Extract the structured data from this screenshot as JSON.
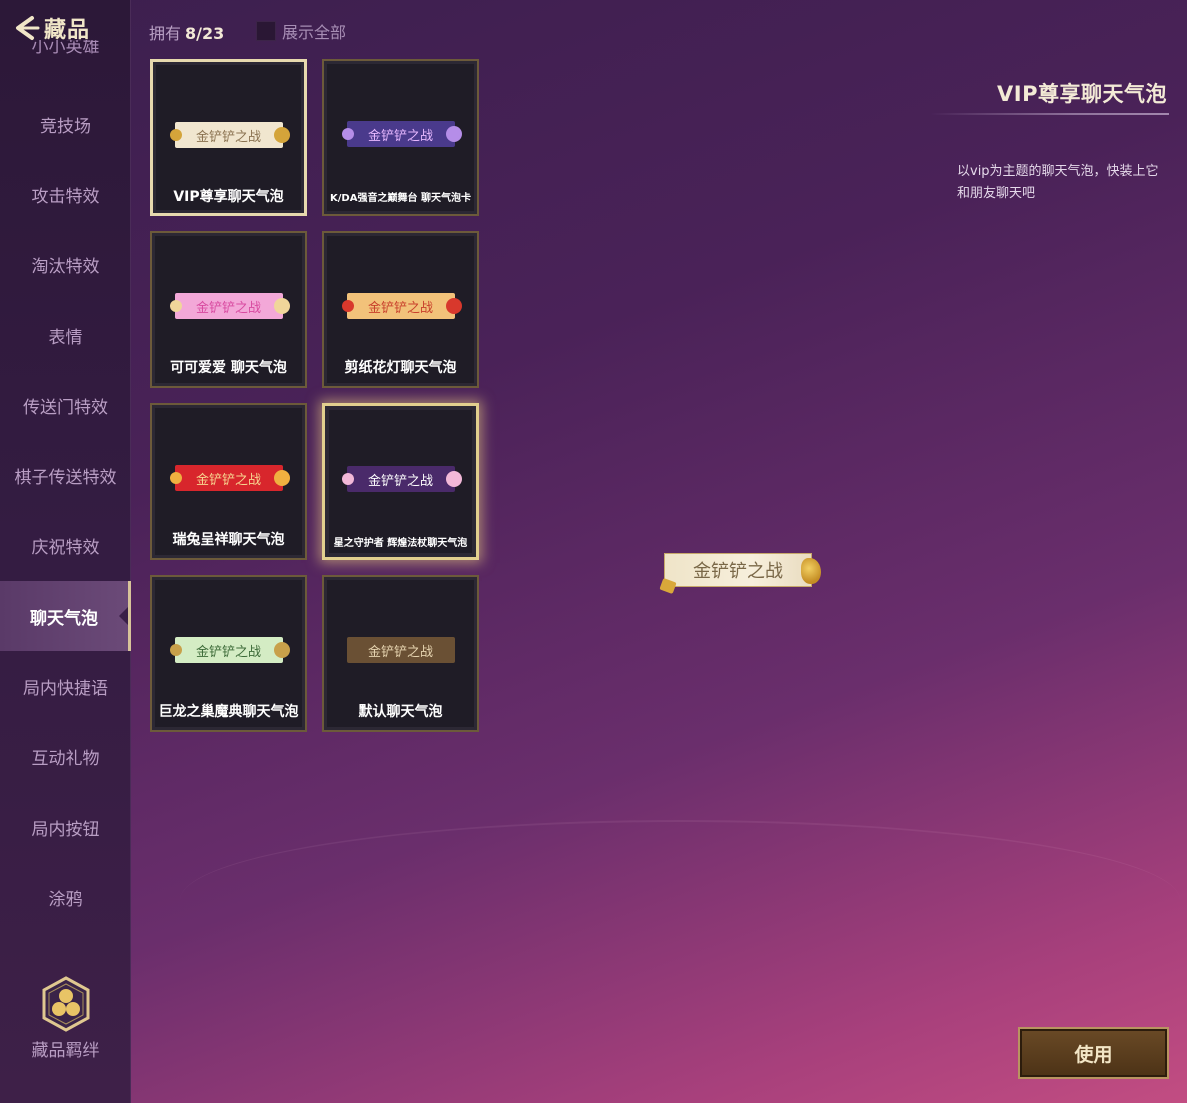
{
  "header": {
    "title": "藏品",
    "owned_label": "拥有",
    "owned_count": "8/23",
    "show_all_label": "展示全部"
  },
  "sidebar": {
    "cut_item": "小小英雄",
    "items": [
      {
        "label": "竞技场"
      },
      {
        "label": "攻击特效"
      },
      {
        "label": "淘汰特效"
      },
      {
        "label": "表情"
      },
      {
        "label": "传送门特效"
      },
      {
        "label": "棋子传送特效"
      },
      {
        "label": "庆祝特效"
      },
      {
        "label": "聊天气泡",
        "active": true
      },
      {
        "label": "局内快捷语"
      },
      {
        "label": "互动礼物"
      },
      {
        "label": "局内按钮"
      },
      {
        "label": "涂鸦"
      }
    ],
    "bond_label": "藏品羁绊"
  },
  "cards": [
    {
      "name": "VIP尊享聊天气泡",
      "bubble_text": "金铲铲之战",
      "bg": "#f1e6cf",
      "fg": "#8a7250",
      "deco": "#d4a43a",
      "state": "equipped"
    },
    {
      "name": "K/DA强音之巅舞台 聊天气泡卡",
      "bubble_text": "金铲铲之战",
      "bg": "#4a3a8c",
      "fg": "#e7b8ff",
      "deco": "#b58de8",
      "state": "",
      "small": true
    },
    {
      "name": "可可爱爱 聊天气泡",
      "bubble_text": "金铲铲之战",
      "bg": "#f3a8d8",
      "fg": "#d84aa0",
      "deco": "#f0d69a",
      "state": ""
    },
    {
      "name": "剪纸花灯聊天气泡",
      "bubble_text": "金铲铲之战",
      "bg": "#f2c27a",
      "fg": "#c8402c",
      "deco": "#d8382c",
      "state": ""
    },
    {
      "name": "瑞兔呈祥聊天气泡",
      "bubble_text": "金铲铲之战",
      "bg": "#d8262c",
      "fg": "#f7d690",
      "deco": "#f0b040",
      "state": ""
    },
    {
      "name": "星之守护者 辉煌法杖聊天气泡",
      "bubble_text": "金铲铲之战",
      "bg": "#4a2a6a",
      "fg": "#ffffff",
      "deco": "#f2b8d8",
      "state": "selected",
      "small": true
    },
    {
      "name": "巨龙之巢魔典聊天气泡",
      "bubble_text": "金铲铲之战",
      "bg": "#d4ecc4",
      "fg": "#3c6a38",
      "deco": "#c8a04a",
      "state": ""
    },
    {
      "name": "默认聊天气泡",
      "bubble_text": "金铲铲之战",
      "bg": "#6a5034",
      "fg": "#e6d4b0",
      "deco": "",
      "state": ""
    }
  ],
  "detail": {
    "title": "VIP尊享聊天气泡",
    "description": "以vip为主题的聊天气泡，快装上它和朋友聊天吧",
    "preview_text": "金铲铲之战"
  },
  "actions": {
    "use_label": "使用"
  }
}
